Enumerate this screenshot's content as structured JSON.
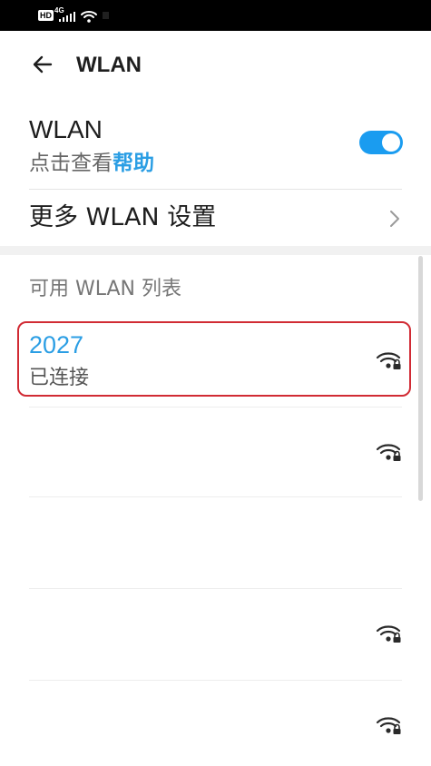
{
  "status_bar": {
    "hd_label": "HD",
    "network_label": "4G"
  },
  "header": {
    "title": "WLAN"
  },
  "wlan": {
    "title": "WLAN",
    "subtitle_prefix": "点击查看",
    "help_link": "帮助",
    "enabled": true
  },
  "more_settings": {
    "label": "更多 WLAN 设置"
  },
  "available_networks": {
    "title": "可用 WLAN 列表",
    "items": [
      {
        "name": "2027",
        "status": "已连接",
        "secured": true,
        "icon": "wifi-lock-icon"
      },
      {
        "name": "",
        "status": "",
        "secured": true,
        "icon": "wifi-lock-icon"
      },
      {
        "name": "",
        "status": "",
        "secured": true,
        "icon": "wifi-empty"
      },
      {
        "name": "",
        "status": "",
        "secured": true,
        "icon": "wifi-lock-icon"
      },
      {
        "name": "",
        "status": "",
        "secured": true,
        "icon": "wifi-lock-icon"
      }
    ]
  },
  "colors": {
    "accent": "#2b9ee4",
    "toggle": "#1a9cf0",
    "highlight": "#d12b34",
    "status_bar": "#000000"
  }
}
